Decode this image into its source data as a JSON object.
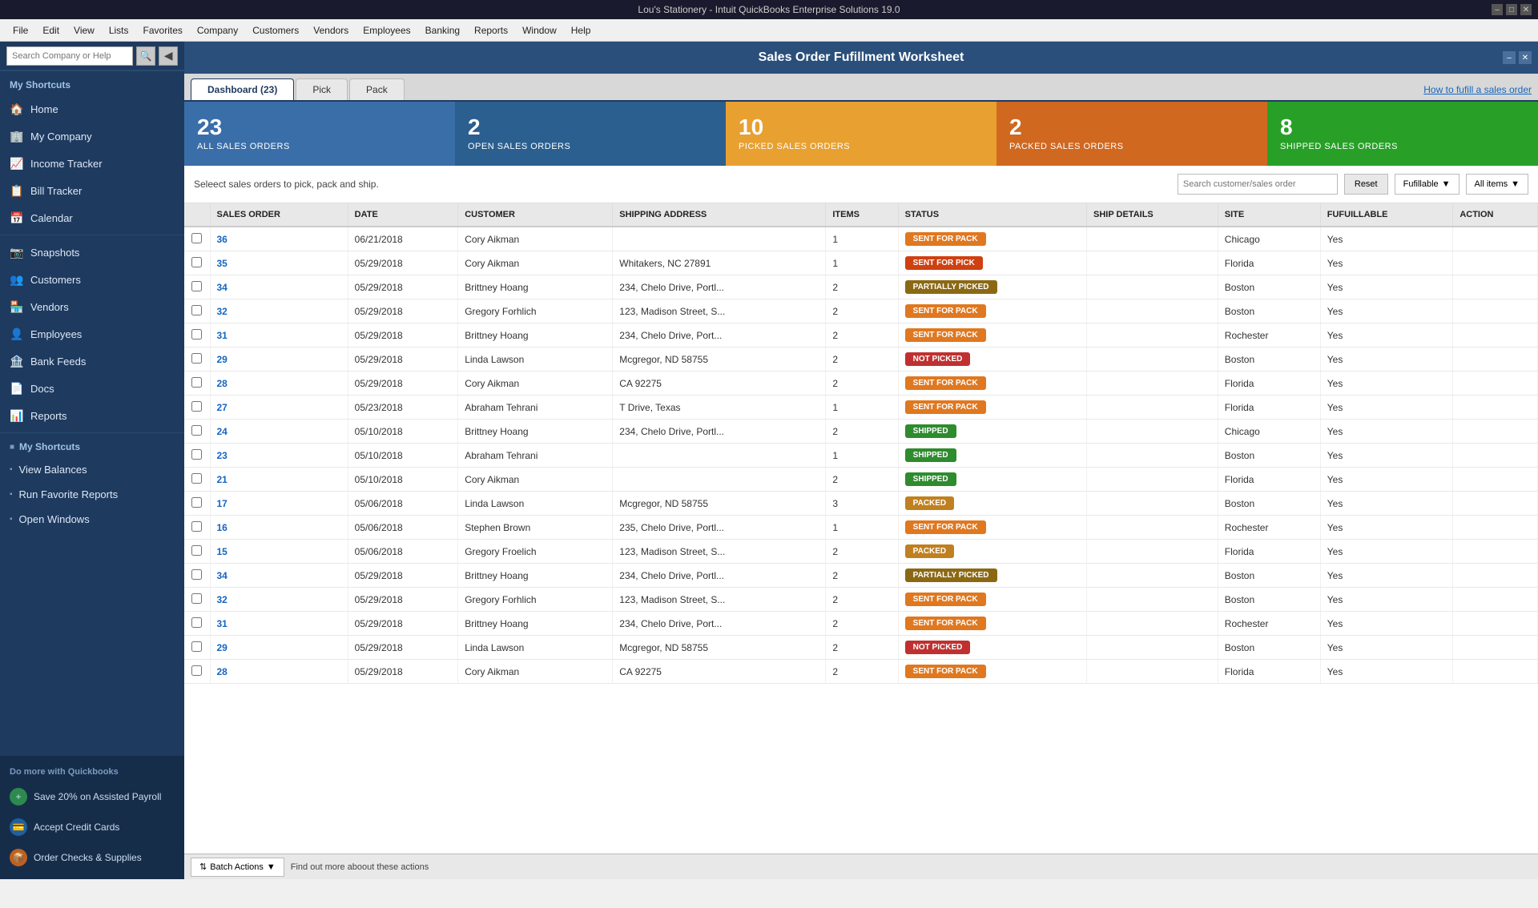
{
  "titleBar": {
    "title": "Lou's Stationery - Intuit QuickBooks Enterprise Solutions 19.0",
    "minimize": "–",
    "maximize": "□",
    "close": "✕"
  },
  "menuBar": {
    "items": [
      "File",
      "Edit",
      "View",
      "Lists",
      "Favorites",
      "Company",
      "Customers",
      "Vendors",
      "Employees",
      "Banking",
      "Reports",
      "Window",
      "Help"
    ]
  },
  "searchBar": {
    "placeholder": "Search Company or Help",
    "collapseIcon": "◀"
  },
  "sidebar": {
    "sectionTitle": "My Shortcuts",
    "items": [
      {
        "label": "Home",
        "icon": "🏠"
      },
      {
        "label": "My Company",
        "icon": "🏢"
      },
      {
        "label": "Income Tracker",
        "icon": "📈"
      },
      {
        "label": "Bill Tracker",
        "icon": "📋"
      },
      {
        "label": "Calendar",
        "icon": "📅"
      },
      {
        "label": "Snapshots",
        "icon": "📷"
      },
      {
        "label": "Customers",
        "icon": "👥"
      },
      {
        "label": "Vendors",
        "icon": "🏪"
      },
      {
        "label": "Employees",
        "icon": "👤"
      },
      {
        "label": "Bank Feeds",
        "icon": "🏦"
      },
      {
        "label": "Docs",
        "icon": "📄"
      },
      {
        "label": "Reports",
        "icon": "📊"
      }
    ],
    "shortcuts": {
      "sectionTitle": "My Shortcuts",
      "items": [
        {
          "label": "View Balances",
          "icon": "≡"
        },
        {
          "label": "Run Favorite Reports",
          "icon": "≡"
        },
        {
          "label": "Open Windows",
          "icon": "≡"
        }
      ]
    },
    "bottom": {
      "sectionTitle": "Do more with Quickbooks",
      "items": [
        {
          "label": "Save 20% on Assisted Payroll",
          "icon": "+"
        },
        {
          "label": "Accept Credit Cards",
          "icon": "💳"
        },
        {
          "label": "Order Checks & Supplies",
          "icon": "📦"
        }
      ]
    }
  },
  "contentHeader": {
    "title": "Sales Order Fufillment Worksheet"
  },
  "tabs": [
    {
      "label": "Dashboard (23)",
      "active": true
    },
    {
      "label": "Pick",
      "active": false
    },
    {
      "label": "Pack",
      "active": false
    }
  ],
  "howToLink": "How to fufill a sales order",
  "stats": [
    {
      "number": "23",
      "label": "ALL SALES ORDERS"
    },
    {
      "number": "2",
      "label": "OPEN SALES ORDERS"
    },
    {
      "number": "10",
      "label": "PICKED SALES ORDERS"
    },
    {
      "number": "2",
      "label": "PACKED SALES ORDERS"
    },
    {
      "number": "8",
      "label": "SHIPPED SALES ORDERS"
    }
  ],
  "controls": {
    "hint": "Seleect sales orders to pick, pack and ship.",
    "searchPlaceholder": "Search customer/sales order",
    "resetLabel": "Reset",
    "filterLabel": "Fufillable",
    "allItemsLabel": "All items"
  },
  "table": {
    "columns": [
      "",
      "SALES ORDER",
      "DATE",
      "CUSTOMER",
      "SHIPPING ADDRESS",
      "ITEMS",
      "STATUS",
      "SHIP DETAILS",
      "SITE",
      "FUFUILLABLE",
      "ACTION"
    ],
    "rows": [
      {
        "salesOrder": "36",
        "date": "06/21/2018",
        "customer": "Cory Aikman",
        "address": "",
        "items": "1",
        "status": "SENT FOR PACK",
        "statusClass": "badge-sent-pack",
        "shipDetails": "",
        "site": "Chicago",
        "fulfillable": "Yes",
        "action": ""
      },
      {
        "salesOrder": "35",
        "date": "05/29/2018",
        "customer": "Cory Aikman",
        "address": "Whitakers, NC 27891",
        "items": "1",
        "status": "SENT FOR PICK",
        "statusClass": "badge-sent-pick",
        "shipDetails": "",
        "site": "Florida",
        "fulfillable": "Yes",
        "action": ""
      },
      {
        "salesOrder": "34",
        "date": "05/29/2018",
        "customer": "Brittney Hoang",
        "address": "234, Chelo Drive, Portl...",
        "items": "2",
        "status": "PARTIALLY PICKED",
        "statusClass": "badge-partially-picked",
        "shipDetails": "",
        "site": "Boston",
        "fulfillable": "Yes",
        "action": ""
      },
      {
        "salesOrder": "32",
        "date": "05/29/2018",
        "customer": "Gregory Forhlich",
        "address": "123, Madison Street, S...",
        "items": "2",
        "status": "SENT FOR PACK",
        "statusClass": "badge-sent-pack",
        "shipDetails": "",
        "site": "Boston",
        "fulfillable": "Yes",
        "action": ""
      },
      {
        "salesOrder": "31",
        "date": "05/29/2018",
        "customer": "Brittney Hoang",
        "address": "234, Chelo Drive, Port...",
        "items": "2",
        "status": "SENT FOR PACK",
        "statusClass": "badge-sent-pack",
        "shipDetails": "",
        "site": "Rochester",
        "fulfillable": "Yes",
        "action": ""
      },
      {
        "salesOrder": "29",
        "date": "05/29/2018",
        "customer": "Linda Lawson",
        "address": "Mcgregor, ND 58755",
        "items": "2",
        "status": "NOT PICKED",
        "statusClass": "badge-not-picked",
        "shipDetails": "",
        "site": "Boston",
        "fulfillable": "Yes",
        "action": ""
      },
      {
        "salesOrder": "28",
        "date": "05/29/2018",
        "customer": "Cory Aikman",
        "address": "CA 92275",
        "items": "2",
        "status": "SENT FOR PACK",
        "statusClass": "badge-sent-pack",
        "shipDetails": "",
        "site": "Florida",
        "fulfillable": "Yes",
        "action": ""
      },
      {
        "salesOrder": "27",
        "date": "05/23/2018",
        "customer": "Abraham Tehrani",
        "address": "T Drive, Texas",
        "items": "1",
        "status": "SENT FOR PACK",
        "statusClass": "badge-sent-pack",
        "shipDetails": "",
        "site": "Florida",
        "fulfillable": "Yes",
        "action": ""
      },
      {
        "salesOrder": "24",
        "date": "05/10/2018",
        "customer": "Brittney Hoang",
        "address": "234, Chelo Drive, Portl...",
        "items": "2",
        "status": "SHIPPED",
        "statusClass": "badge-shipped",
        "shipDetails": "",
        "site": "Chicago",
        "fulfillable": "Yes",
        "action": ""
      },
      {
        "salesOrder": "23",
        "date": "05/10/2018",
        "customer": "Abraham Tehrani",
        "address": "",
        "items": "1",
        "status": "SHIPPED",
        "statusClass": "badge-shipped",
        "shipDetails": "",
        "site": "Boston",
        "fulfillable": "Yes",
        "action": ""
      },
      {
        "salesOrder": "21",
        "date": "05/10/2018",
        "customer": "Cory Aikman",
        "address": "",
        "items": "2",
        "status": "SHIPPED",
        "statusClass": "badge-shipped",
        "shipDetails": "",
        "site": "Florida",
        "fulfillable": "Yes",
        "action": ""
      },
      {
        "salesOrder": "17",
        "date": "05/06/2018",
        "customer": "Linda Lawson",
        "address": "Mcgregor, ND 58755",
        "items": "3",
        "status": "PACKED",
        "statusClass": "badge-packed",
        "shipDetails": "",
        "site": "Boston",
        "fulfillable": "Yes",
        "action": ""
      },
      {
        "salesOrder": "16",
        "date": "05/06/2018",
        "customer": "Stephen Brown",
        "address": "235, Chelo Drive, Portl...",
        "items": "1",
        "status": "SENT FOR PACK",
        "statusClass": "badge-sent-pack",
        "shipDetails": "",
        "site": "Rochester",
        "fulfillable": "Yes",
        "action": ""
      },
      {
        "salesOrder": "15",
        "date": "05/06/2018",
        "customer": "Gregory Froelich",
        "address": "123, Madison Street, S...",
        "items": "2",
        "status": "PACKED",
        "statusClass": "badge-packed",
        "shipDetails": "",
        "site": "Florida",
        "fulfillable": "Yes",
        "action": ""
      },
      {
        "salesOrder": "34",
        "date": "05/29/2018",
        "customer": "Brittney Hoang",
        "address": "234, Chelo Drive, Portl...",
        "items": "2",
        "status": "PARTIALLY PICKED",
        "statusClass": "badge-partially-picked",
        "shipDetails": "",
        "site": "Boston",
        "fulfillable": "Yes",
        "action": ""
      },
      {
        "salesOrder": "32",
        "date": "05/29/2018",
        "customer": "Gregory Forhlich",
        "address": "123, Madison Street, S...",
        "items": "2",
        "status": "SENT FOR PACK",
        "statusClass": "badge-sent-pack",
        "shipDetails": "",
        "site": "Boston",
        "fulfillable": "Yes",
        "action": ""
      },
      {
        "salesOrder": "31",
        "date": "05/29/2018",
        "customer": "Brittney Hoang",
        "address": "234, Chelo Drive, Port...",
        "items": "2",
        "status": "SENT FOR PACK",
        "statusClass": "badge-sent-pack",
        "shipDetails": "",
        "site": "Rochester",
        "fulfillable": "Yes",
        "action": ""
      },
      {
        "salesOrder": "29",
        "date": "05/29/2018",
        "customer": "Linda Lawson",
        "address": "Mcgregor, ND 58755",
        "items": "2",
        "status": "NOT PICKED",
        "statusClass": "badge-not-picked",
        "shipDetails": "",
        "site": "Boston",
        "fulfillable": "Yes",
        "action": ""
      },
      {
        "salesOrder": "28",
        "date": "05/29/2018",
        "customer": "Cory Aikman",
        "address": "CA 92275",
        "items": "2",
        "status": "SENT FOR PACK",
        "statusClass": "badge-sent-pack",
        "shipDetails": "",
        "site": "Florida",
        "fulfillable": "Yes",
        "action": ""
      }
    ]
  },
  "bottomBar": {
    "batchActionsLabel": "Batch Actions",
    "findOutMoreText": "Find out more aboout these actions"
  }
}
